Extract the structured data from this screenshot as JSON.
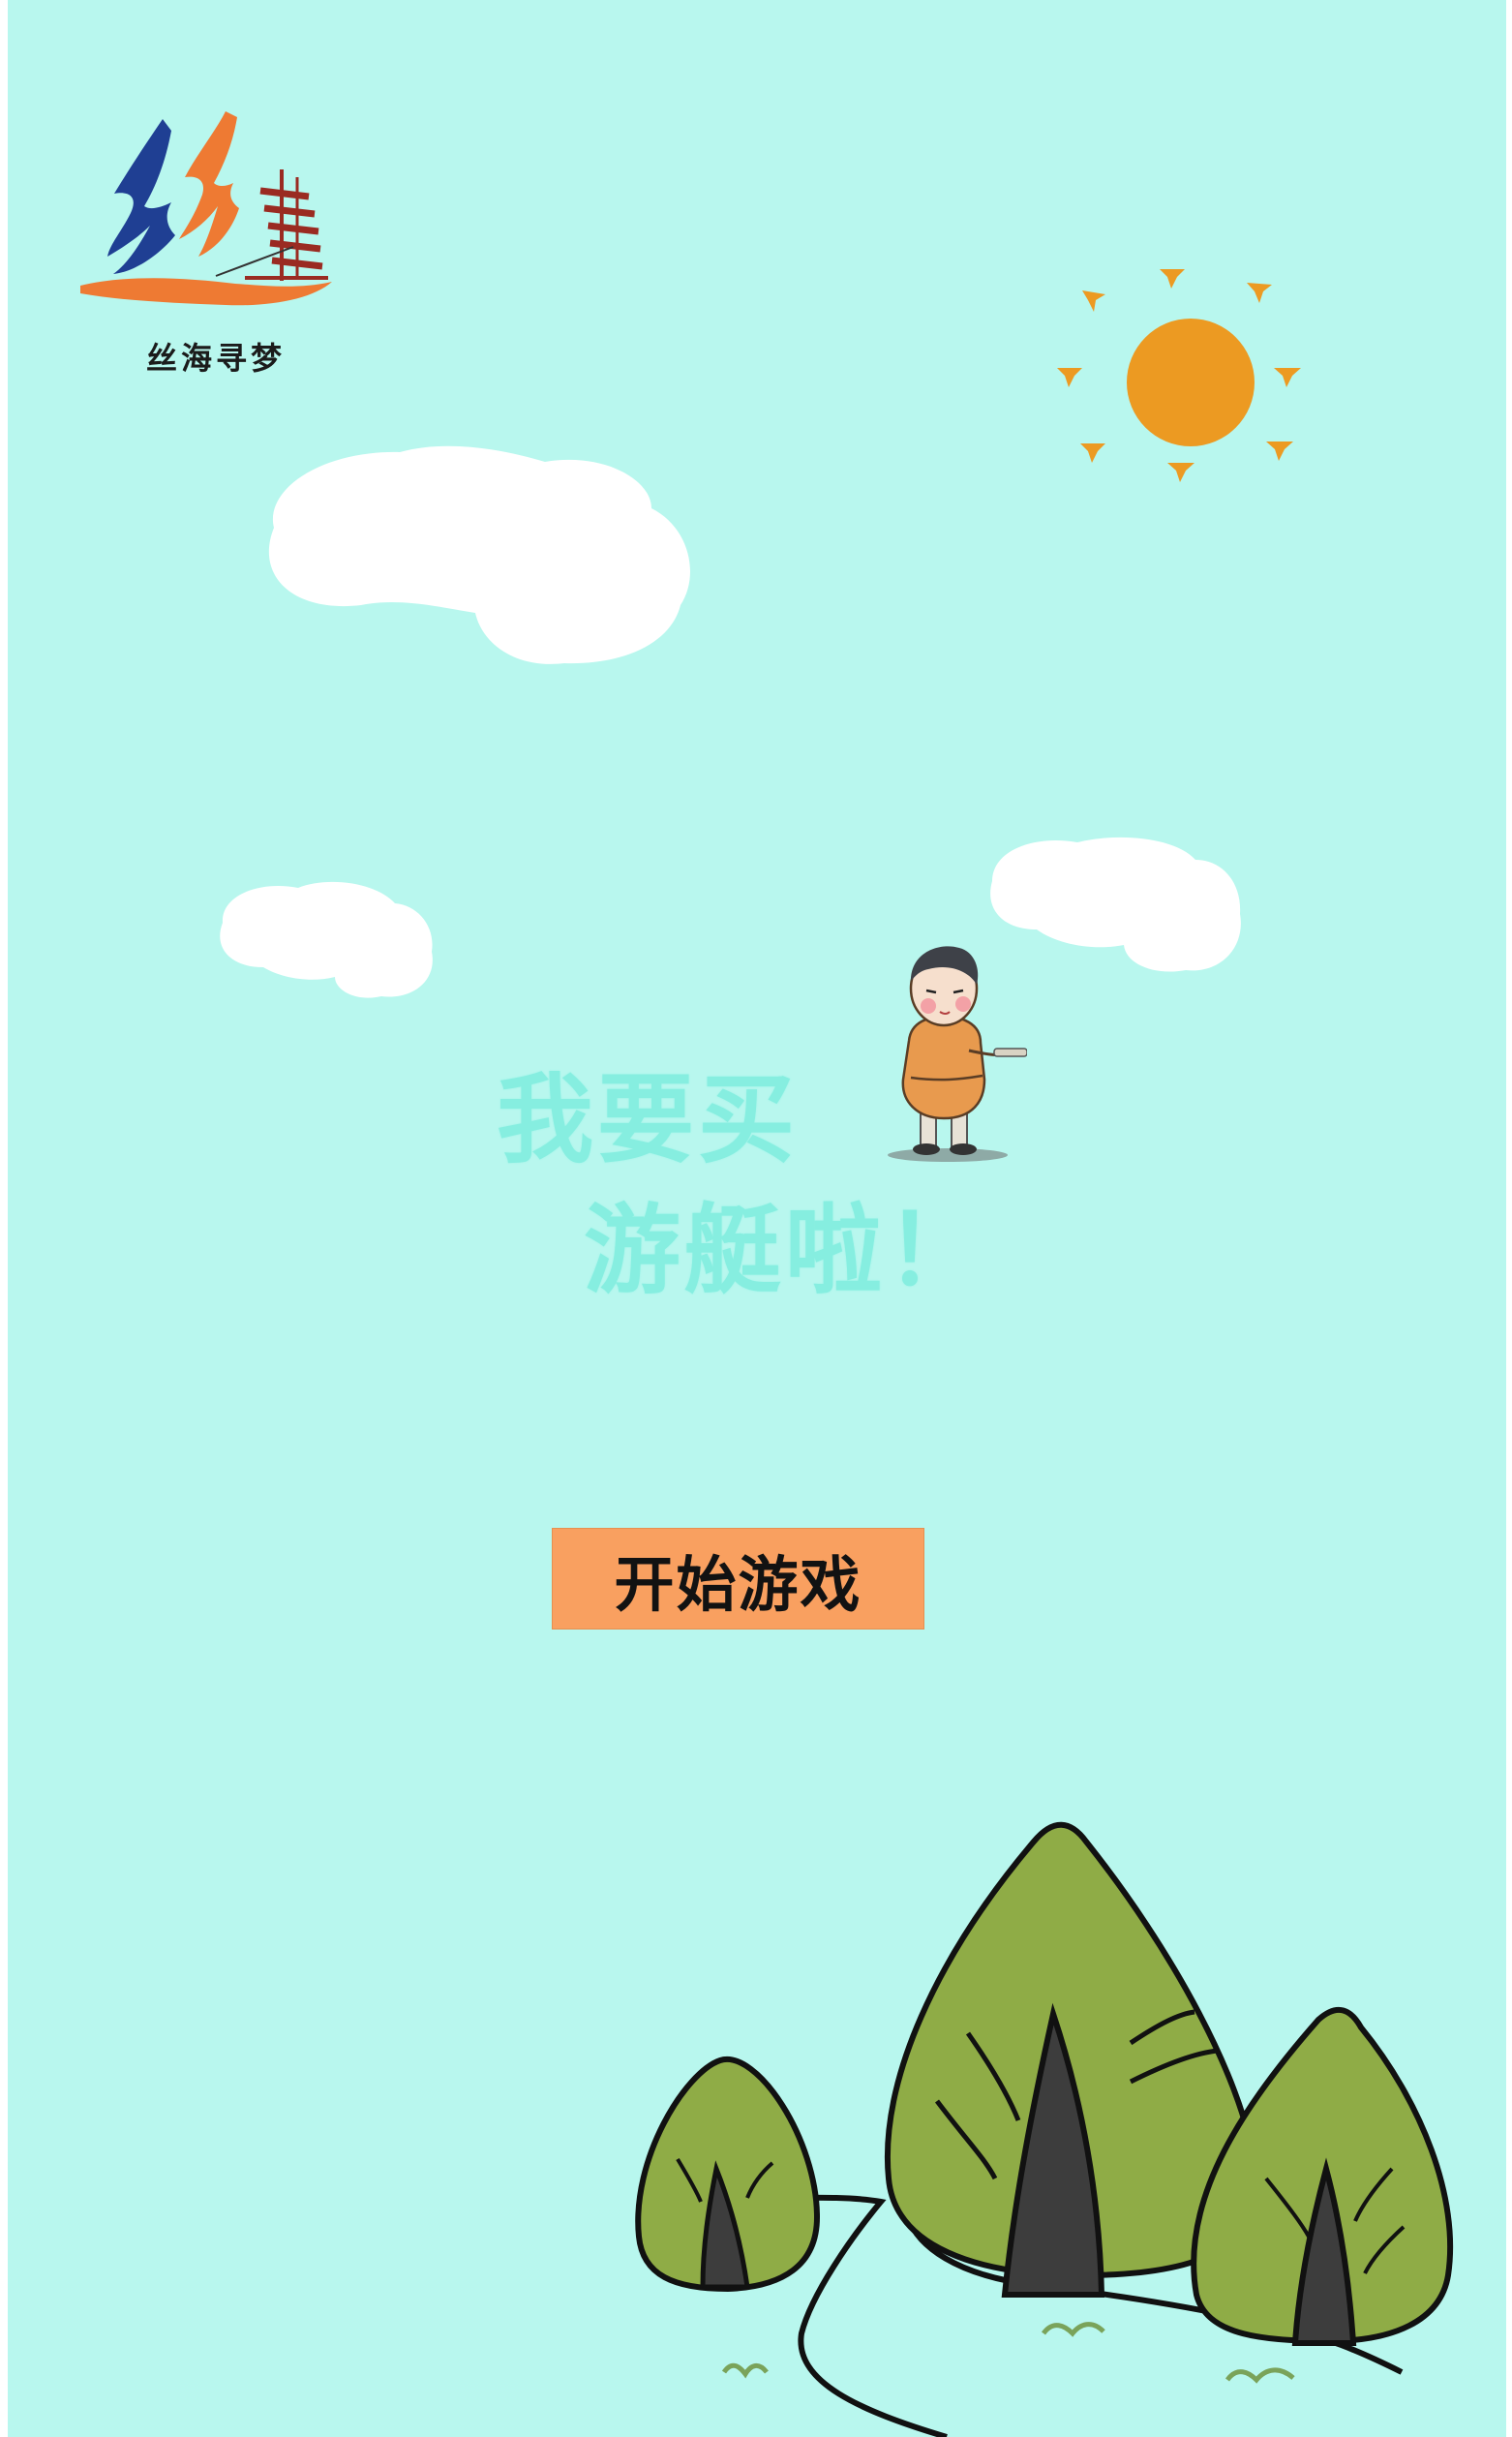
{
  "logo": {
    "caption": "丝海寻梦",
    "mark_text": "丝",
    "icon": "sailing-ship-icon"
  },
  "title": {
    "line1": "我要买",
    "line2": "游艇啦！"
  },
  "start_button": {
    "label": "开始游戏"
  },
  "colors": {
    "background": "#b8f7ee",
    "title_text": "#86eee0",
    "button_bg": "#f9a060",
    "sun": "#ec9a22",
    "cloud": "#ffffff",
    "tree_green": "#8fac46",
    "tree_trunk": "#3d3d3d",
    "logo_blue": "#1f3f93",
    "logo_orange": "#ee7a33",
    "logo_ship": "#9a2b22"
  },
  "decor": {
    "sun_icon": "sun-icon",
    "cloud_icon": "cloud-icon",
    "character_icon": "boy-character-icon",
    "tree_icon": "tree-icon"
  }
}
